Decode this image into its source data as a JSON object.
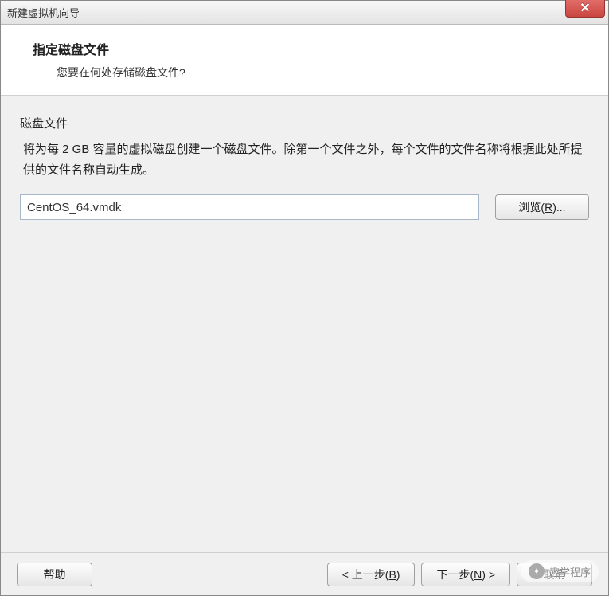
{
  "window": {
    "title": "新建虚拟机向导"
  },
  "header": {
    "title": "指定磁盘文件",
    "subtitle": "您要在何处存储磁盘文件?"
  },
  "content": {
    "section_label": "磁盘文件",
    "section_desc": "将为每 2 GB 容量的虚拟磁盘创建一个磁盘文件。除第一个文件之外，每个文件的文件名称将根据此处所提供的文件名称自动生成。",
    "file_value": "CentOS_64.vmdk",
    "browse_label": "浏览(",
    "browse_key": "R",
    "browse_suffix": ")..."
  },
  "footer": {
    "help_label": "帮助",
    "back_label": "< 上一步(",
    "back_key": "B",
    "back_suffix": ")",
    "next_label": "下一步(",
    "next_key": "N",
    "next_suffix": ") >",
    "cancel_label": "取消"
  },
  "watermark": {
    "text": "趣学程序"
  }
}
